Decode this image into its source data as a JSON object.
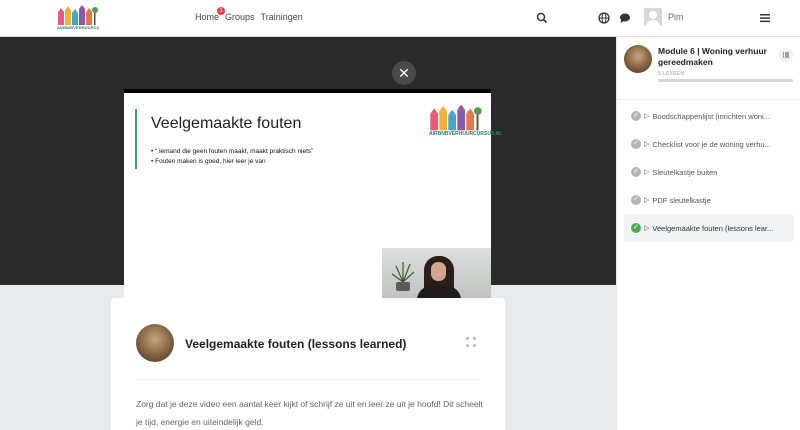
{
  "brand": {
    "name": "AIRBNBVERHUURCURSUS.NL"
  },
  "nav": {
    "home": "Home",
    "home_badge": "1",
    "groups": "Groups",
    "trainingen": "Trainingen"
  },
  "user": {
    "name": "Pim"
  },
  "slide": {
    "title": "Veelgemaakte fouten",
    "bullets": [
      "“ iemand die geen fouten maakt, maakt praktisch niets”",
      "Fouten maken is goed, hier leer je van"
    ]
  },
  "lesson": {
    "title": "Veelgemaakte fouten (lessons learned)",
    "text": "Zorg dat je deze video een aantal keer kijkt of schrijf ze uit en leer ze uit je hoofd! Dit scheelt je tijd, energie en uiteindelijk geld."
  },
  "module": {
    "title": "Module 6 | Woning verhuur gereedmaken",
    "count": "5 LESSEN",
    "lessons": [
      {
        "label": "Boodschappenlijst (inrichten woni...",
        "status": "viewed"
      },
      {
        "label": "Checklist voor je de woning verhu...",
        "status": "viewed"
      },
      {
        "label": "Sleutelkastje buiten",
        "status": "viewed"
      },
      {
        "label": "PDF sleutelkastje",
        "status": "viewed"
      },
      {
        "label": "Veelgemaakte fouten (lessons lear...",
        "status": "completed"
      }
    ]
  },
  "colors": {
    "accent_green": "#4caf50",
    "badge_red": "#ef3e46",
    "video_bg": "#2a2a2a"
  },
  "icons": {
    "search": "search-icon",
    "globe": "globe-icon",
    "chat": "chat-icon",
    "menu": "hamburger-menu-icon",
    "close": "close-icon",
    "expand": "expand-icon",
    "list": "list-icon"
  }
}
